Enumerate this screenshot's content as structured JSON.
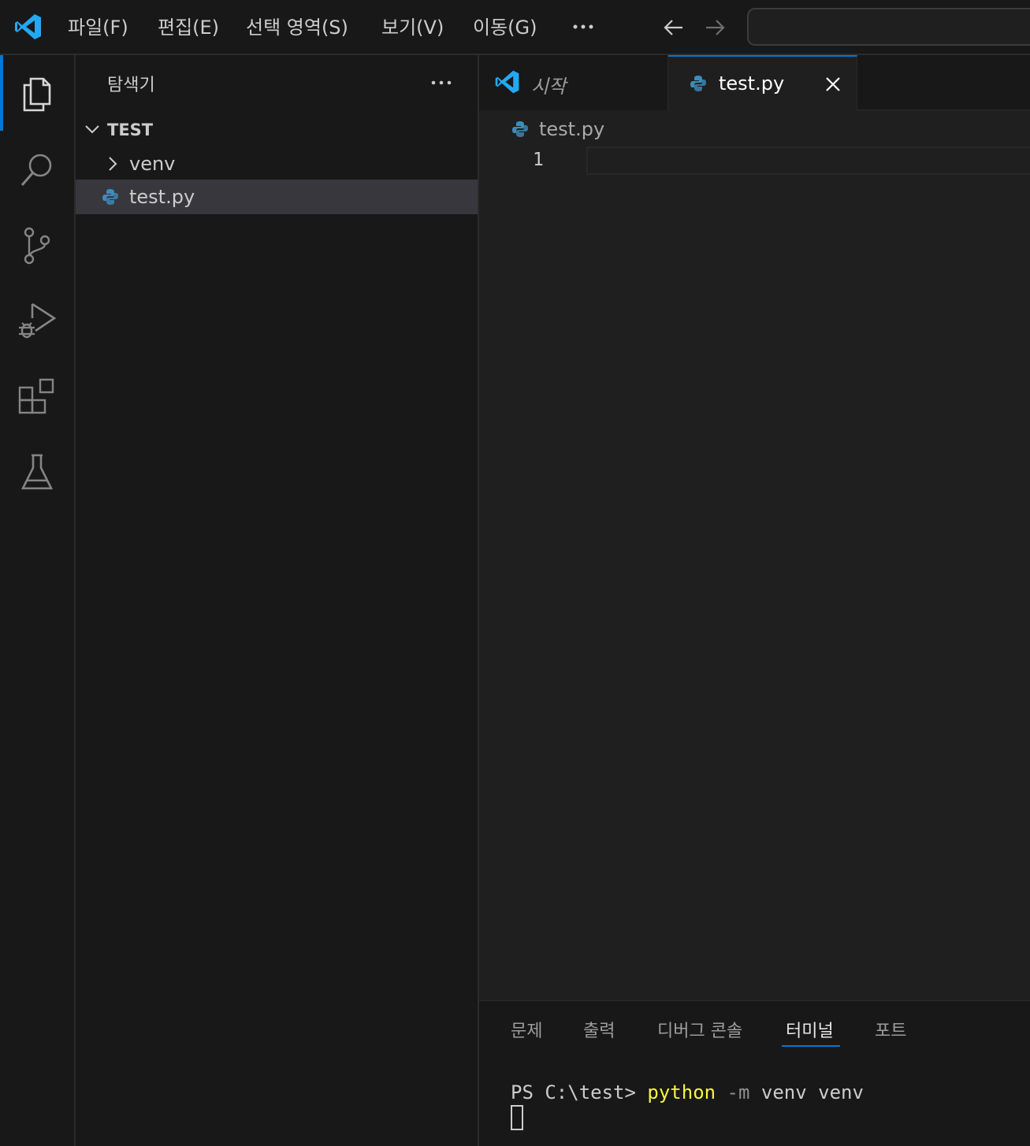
{
  "menubar": {
    "items": [
      "파일(F)",
      "편집(E)",
      "선택 영역(S)",
      "보기(V)",
      "이동(G)"
    ]
  },
  "explorer": {
    "title": "탐색기",
    "folder_name": "TEST",
    "items": [
      {
        "label": "venv",
        "type": "folder"
      },
      {
        "label": "test.py",
        "type": "python-file"
      }
    ]
  },
  "tabs": [
    {
      "label": "시작",
      "icon": "vscode-logo-icon"
    },
    {
      "label": "test.py",
      "icon": "python-icon"
    }
  ],
  "editor": {
    "breadcrumb": "test.py",
    "line_numbers": [
      "1"
    ]
  },
  "panel": {
    "tabs": [
      "문제",
      "출력",
      "디버그 콘솔",
      "터미널",
      "포트"
    ],
    "active_tab": "터미널",
    "terminal": {
      "prompt": "PS C:\\test> ",
      "command": "python",
      "flag": "-m",
      "args": "venv venv"
    }
  },
  "colors": {
    "accent": "#0078d4",
    "python_blue": "#3c8dbc",
    "terminal_command": "#f5f543"
  }
}
